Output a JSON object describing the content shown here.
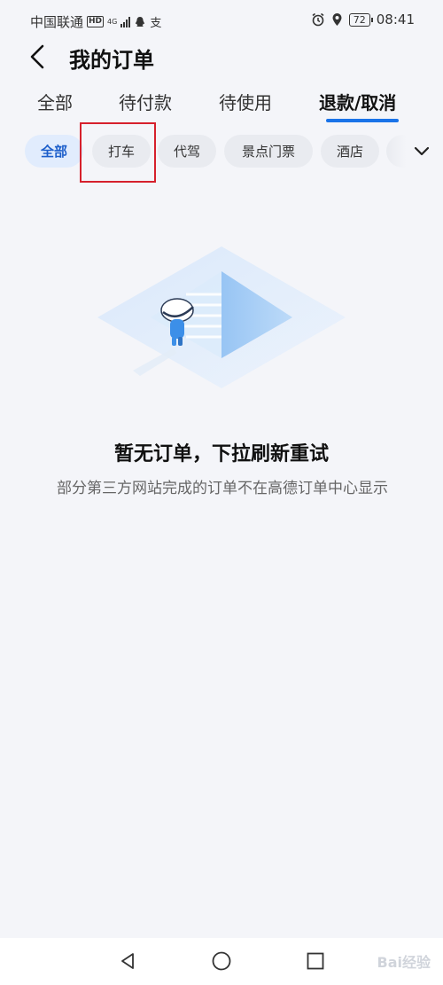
{
  "status_bar": {
    "carrier": "中国联通",
    "hd_badge": "HD",
    "network": "4G",
    "extra_icon_text": "支",
    "battery": "72",
    "time": "08:41"
  },
  "header": {
    "title": "我的订单"
  },
  "tabs": [
    {
      "label": "全部",
      "active": false
    },
    {
      "label": "待付款",
      "active": false
    },
    {
      "label": "待使用",
      "active": false
    },
    {
      "label": "退款/取消",
      "active": true
    }
  ],
  "chips": [
    {
      "label": "全部",
      "active": true
    },
    {
      "label": "打车",
      "active": false
    },
    {
      "label": "代驾",
      "active": false
    },
    {
      "label": "景点门票",
      "active": false
    },
    {
      "label": "酒店",
      "active": false
    }
  ],
  "empty_state": {
    "title": "暂无订单，下拉刷新重试",
    "description": "部分第三方网站完成的订单不在高德订单中心显示"
  },
  "watermark": "Bai经验",
  "colors": {
    "accent": "#1a73e8",
    "highlight_box": "#d6202c",
    "background": "#f4f5f9"
  }
}
